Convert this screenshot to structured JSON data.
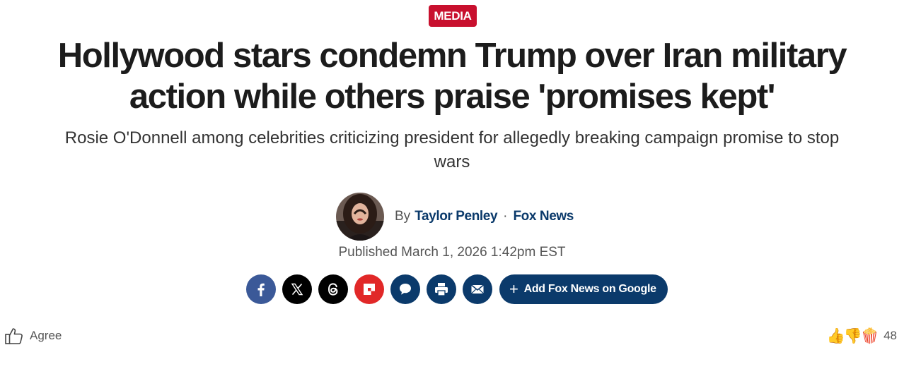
{
  "badge": {
    "label": "MEDIA"
  },
  "article": {
    "headline": "Hollywood stars condemn Trump over Iran military action while others praise 'promises kept'",
    "subheadline": "Rosie O'Donnell among celebrities criticizing president for allegedly breaking campaign promise to stop wars",
    "byline": {
      "by": "By",
      "author": "Taylor Penley",
      "separator": "·",
      "outlet": "Fox News"
    },
    "published": "Published March 1, 2026 1:42pm EST"
  },
  "share": {
    "buttons": [
      {
        "icon": "facebook-icon",
        "color": "#3b5998"
      },
      {
        "icon": "x-icon",
        "color": "#000000"
      },
      {
        "icon": "threads-icon",
        "color": "#000000"
      },
      {
        "icon": "flipboard-icon",
        "color": "#e12828"
      },
      {
        "icon": "comment-icon",
        "color": "#0b3a6b"
      },
      {
        "icon": "print-icon",
        "color": "#0b3a6b"
      },
      {
        "icon": "email-icon",
        "color": "#0b3a6b"
      }
    ],
    "add_google_label": "Add Fox News on Google"
  },
  "reactions": {
    "agree_label": "Agree",
    "emojis": [
      "👍",
      "👎",
      "🍿"
    ],
    "count": "48"
  },
  "colors": {
    "brand_red": "#c8102e",
    "navy": "#0b3a6b"
  }
}
